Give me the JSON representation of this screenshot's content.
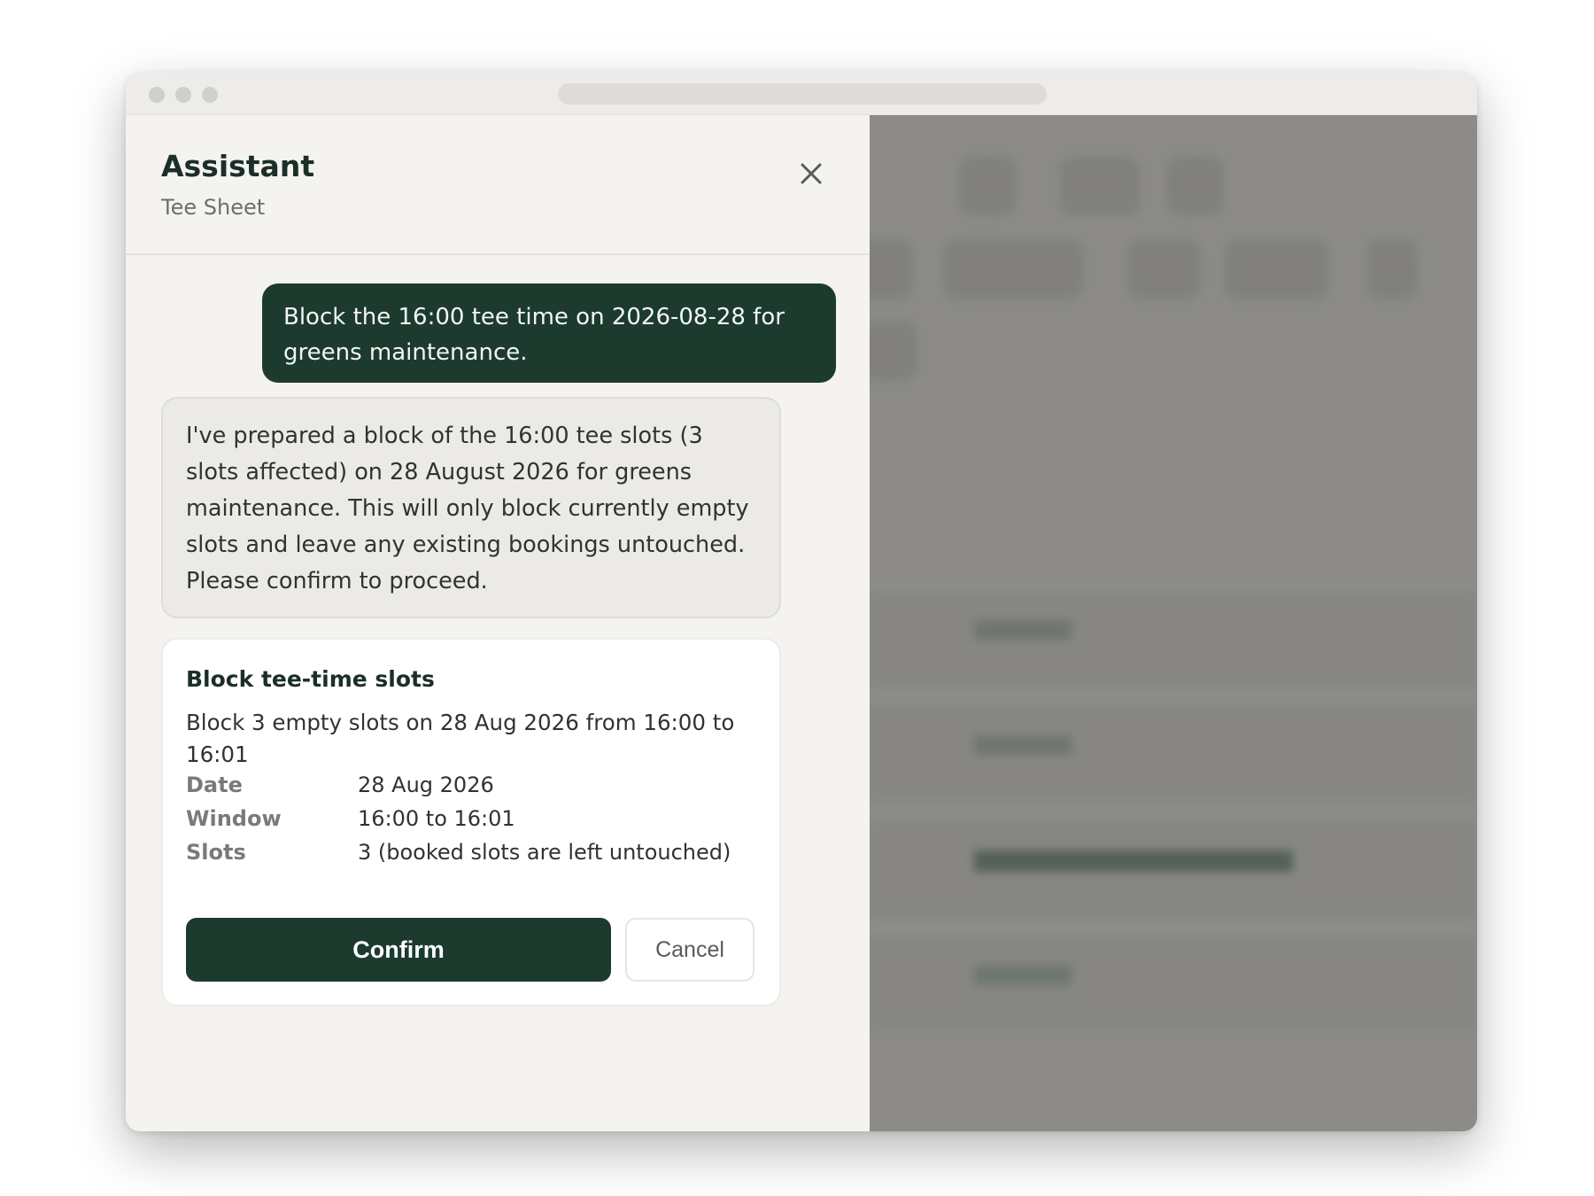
{
  "assistant": {
    "title": "Assistant",
    "subtitle": "Tee Sheet"
  },
  "messages": {
    "user": "Block the 16:00 tee time on 2026-08-28 for greens maintenance.",
    "assistant": "I've prepared a block of the 16:00 tee slots (3 slots affected) on 28 August 2026 for greens maintenance. This will only block currently empty slots and leave any existing bookings untouched. Please confirm to proceed."
  },
  "action_card": {
    "title": "Block tee-time slots",
    "description": "Block 3 empty slots on 28 Aug 2026 from 16:00 to 16:01",
    "details": [
      {
        "label": "Date",
        "value": "28 Aug 2026"
      },
      {
        "label": "Window",
        "value": "16:00 to 16:01"
      },
      {
        "label": "Slots",
        "value": "3 (booked slots are left untouched)"
      }
    ],
    "confirm_label": "Confirm",
    "cancel_label": "Cancel"
  },
  "colors": {
    "primary": "#1c3b2e",
    "panel_bg": "#f4f3ef",
    "overlay": "#8c8b88"
  },
  "icons": {
    "close": "close-icon"
  }
}
